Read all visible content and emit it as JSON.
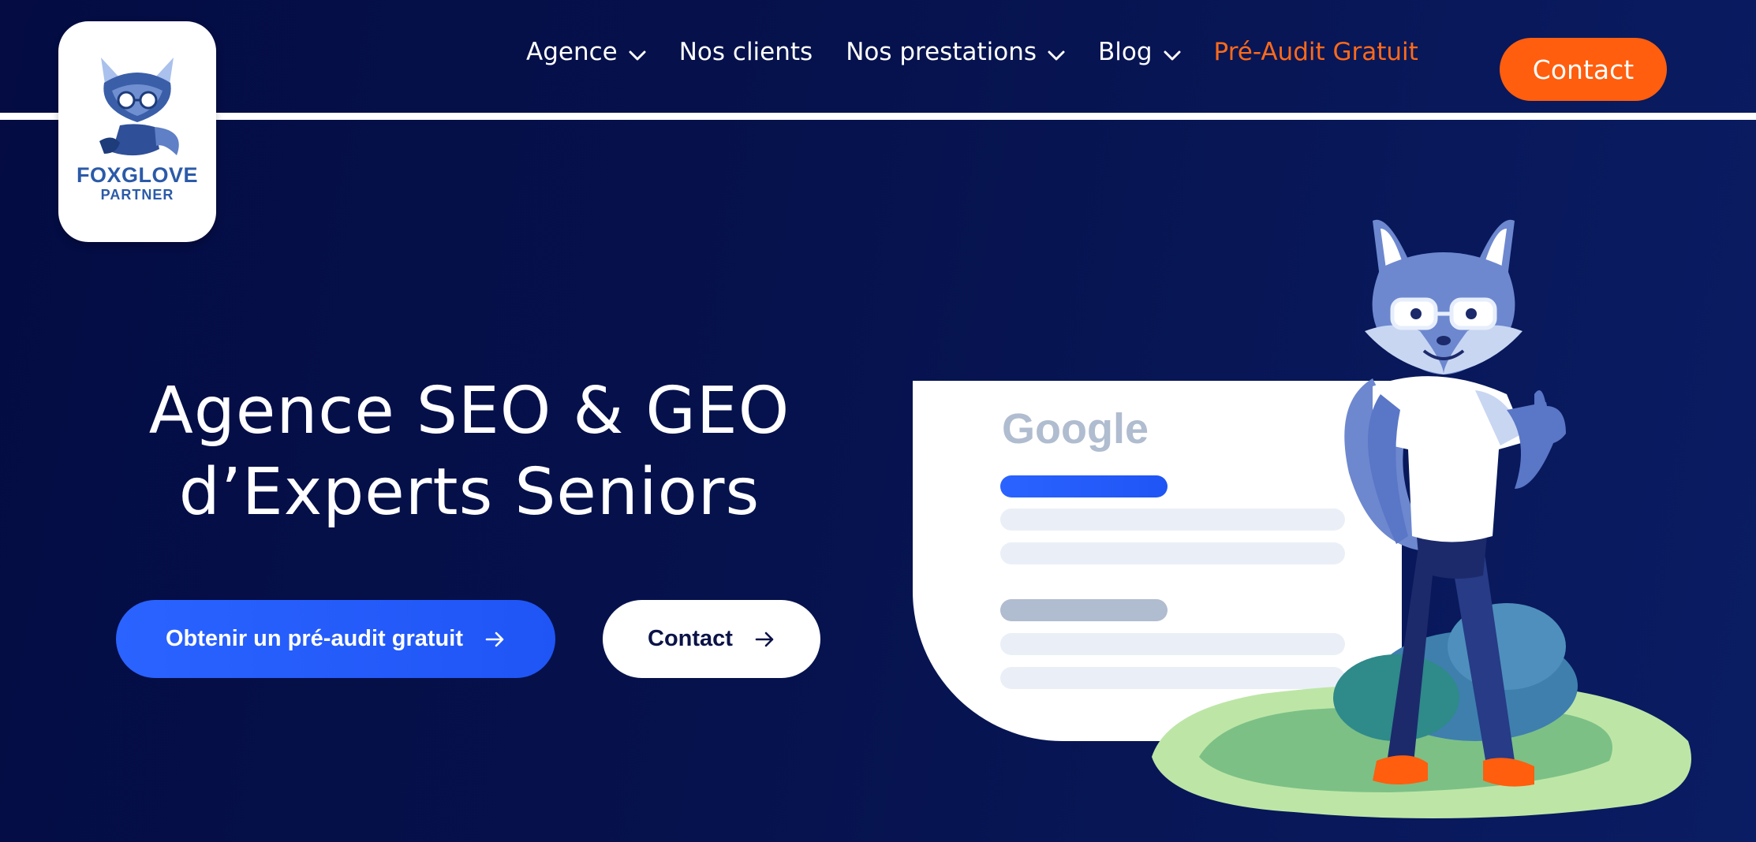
{
  "logo": {
    "name": "FOXGLOVE",
    "sub": "PARTNER"
  },
  "nav": {
    "items": [
      {
        "label": "Agence",
        "has_dropdown": true
      },
      {
        "label": "Nos clients",
        "has_dropdown": false
      },
      {
        "label": "Nos prestations",
        "has_dropdown": true
      },
      {
        "label": "Blog",
        "has_dropdown": true
      }
    ],
    "highlight": "Pré-Audit Gratuit",
    "contact_label": "Contact"
  },
  "hero": {
    "title_line1": "Agence SEO & GEO",
    "title_line2": "d’Experts Seniors",
    "primary_cta": "Obtenir un pré-audit gratuit",
    "secondary_cta": "Contact"
  },
  "google_card": {
    "brand": "Google"
  },
  "colors": {
    "background": "#06124d",
    "accent_orange": "#ff5e0e",
    "accent_blue": "#2a63ff",
    "brand_blue": "#2b5aa8"
  },
  "icons": [
    "chevron-down-icon",
    "arrow-right-icon",
    "fox-logo-icon",
    "fox-mascot-illustration"
  ]
}
